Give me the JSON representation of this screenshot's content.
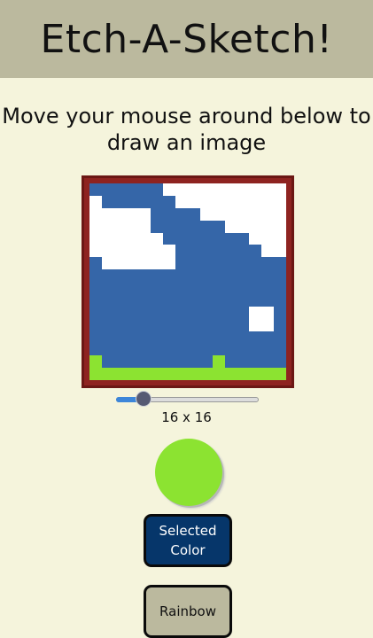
{
  "header": {
    "title": "Etch-A-Sketch!"
  },
  "instructions": "Move your mouse around below to draw an image",
  "canvas": {
    "grid_size": 16,
    "palette": {
      "B": "#3566a8",
      "W": "#ffffff",
      "G": "#8ce331"
    },
    "rows": [
      "BBBBBBWWWWWWWWWW",
      "WBBBBBBWWWWWWWWW",
      "WWWWWBBBBWWWWWWW",
      "WWWWWBBBBBBWWWWW",
      "WWWWWWBBBBBBBWWW",
      "WWWWWWWBBBBBBBWW",
      "BWWWWWWBBBBBBBBB",
      "BBBBBBBBBBBBBBBB",
      "BBBBBBBBBBBBBBBB",
      "BBBBBBBBBBBBBBBB",
      "BBBBBBBBBBBBBWWB",
      "BBBBBBBBBBBBBWWB",
      "BBBBBBBBBBBBBBBB",
      "BBBBBBBBBBBBBBBB",
      "GBBBBBBBBBGBBBBB",
      "GGGGGGGGGGGGGGGG"
    ],
    "frame_color": "#8e2320"
  },
  "slider": {
    "value": 16,
    "min": 16,
    "max": 100
  },
  "size_label": "16 x 16",
  "color_picker": {
    "value": "#8ce331"
  },
  "buttons": {
    "selected_color_label": "Selected Color",
    "rainbow_label": "Rainbow"
  }
}
